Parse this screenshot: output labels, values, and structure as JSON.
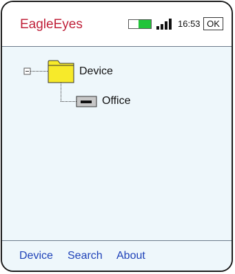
{
  "header": {
    "app_title": "EagleEyes",
    "clock": "16:53",
    "ok_label": "OK",
    "battery_level": 0.56,
    "signal_bars": 4
  },
  "tree": {
    "root_label": "Device",
    "child_label": "Office"
  },
  "footer": {
    "menu": [
      "Device",
      "Search",
      "About"
    ]
  },
  "colors": {
    "title": "#c0213a",
    "menu": "#1f42b8",
    "battery_fill": "#22c43a",
    "folder": "#f7ea2a",
    "background": "#eef7fb"
  }
}
